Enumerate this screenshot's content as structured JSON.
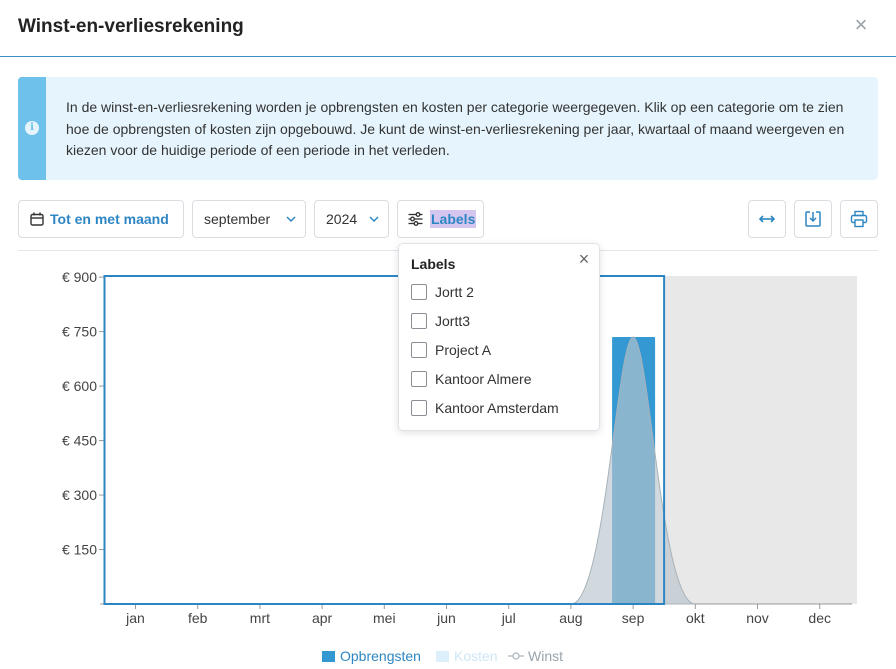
{
  "dialog": {
    "title": "Winst-en-verliesrekening",
    "close_symbol": "×",
    "info_icon": "i",
    "info_text": "In de winst-en-verliesrekening worden je opbrengsten en kosten per categorie weergegeven. Klik op een categorie om te zien hoe de opbrengsten of kosten zijn opgebouwd. Je kunt de winst-en-verliesrekening per jaar, kwartaal of maand weergeven en kiezen voor de huidige periode of een periode in het verleden."
  },
  "toolbar": {
    "period_button": "Tot en met maand",
    "month_select": "september",
    "year_select": "2024",
    "labels_button": "Labels",
    "icons": [
      "expand-icon",
      "download-icon",
      "print-icon"
    ]
  },
  "labels_popup": {
    "title": "Labels",
    "close_symbol": "×",
    "options": [
      "Jortt 2",
      "Jortt3",
      "Project A",
      "Kantoor Almere",
      "Kantoor Amsterdam"
    ]
  },
  "colors": {
    "accent": "#2d86c4",
    "opbrengsten": "#3498d2",
    "kosten": "#dceffa",
    "winst_area": "#b8c4cc",
    "future_shade": "#e8e8e8"
  },
  "chart_data": {
    "type": "bar",
    "categories": [
      "jan",
      "feb",
      "mrt",
      "apr",
      "mei",
      "jun",
      "jul",
      "aug",
      "sep",
      "okt",
      "nov",
      "dec"
    ],
    "series": [
      {
        "name": "Opbrengsten",
        "values": [
          0,
          0,
          0,
          0,
          0,
          0,
          0,
          0,
          735,
          0,
          0,
          0
        ]
      },
      {
        "name": "Kosten",
        "values": [
          0,
          0,
          0,
          0,
          0,
          0,
          0,
          0,
          0,
          0,
          0,
          0
        ]
      },
      {
        "name": "Winst",
        "values": [
          0,
          0,
          0,
          0,
          0,
          0,
          0,
          0,
          735,
          0,
          0,
          0
        ]
      }
    ],
    "y_ticks": [
      "€ 150",
      "€ 300",
      "€ 450",
      "€ 600",
      "€ 750",
      "€ 900"
    ],
    "y_tick_values": [
      150,
      300,
      450,
      600,
      750,
      900
    ],
    "ylim": [
      0,
      900
    ],
    "selected_range": [
      "jan",
      "sep"
    ],
    "future_months_from": "okt",
    "legend_position": "bottom-center"
  }
}
